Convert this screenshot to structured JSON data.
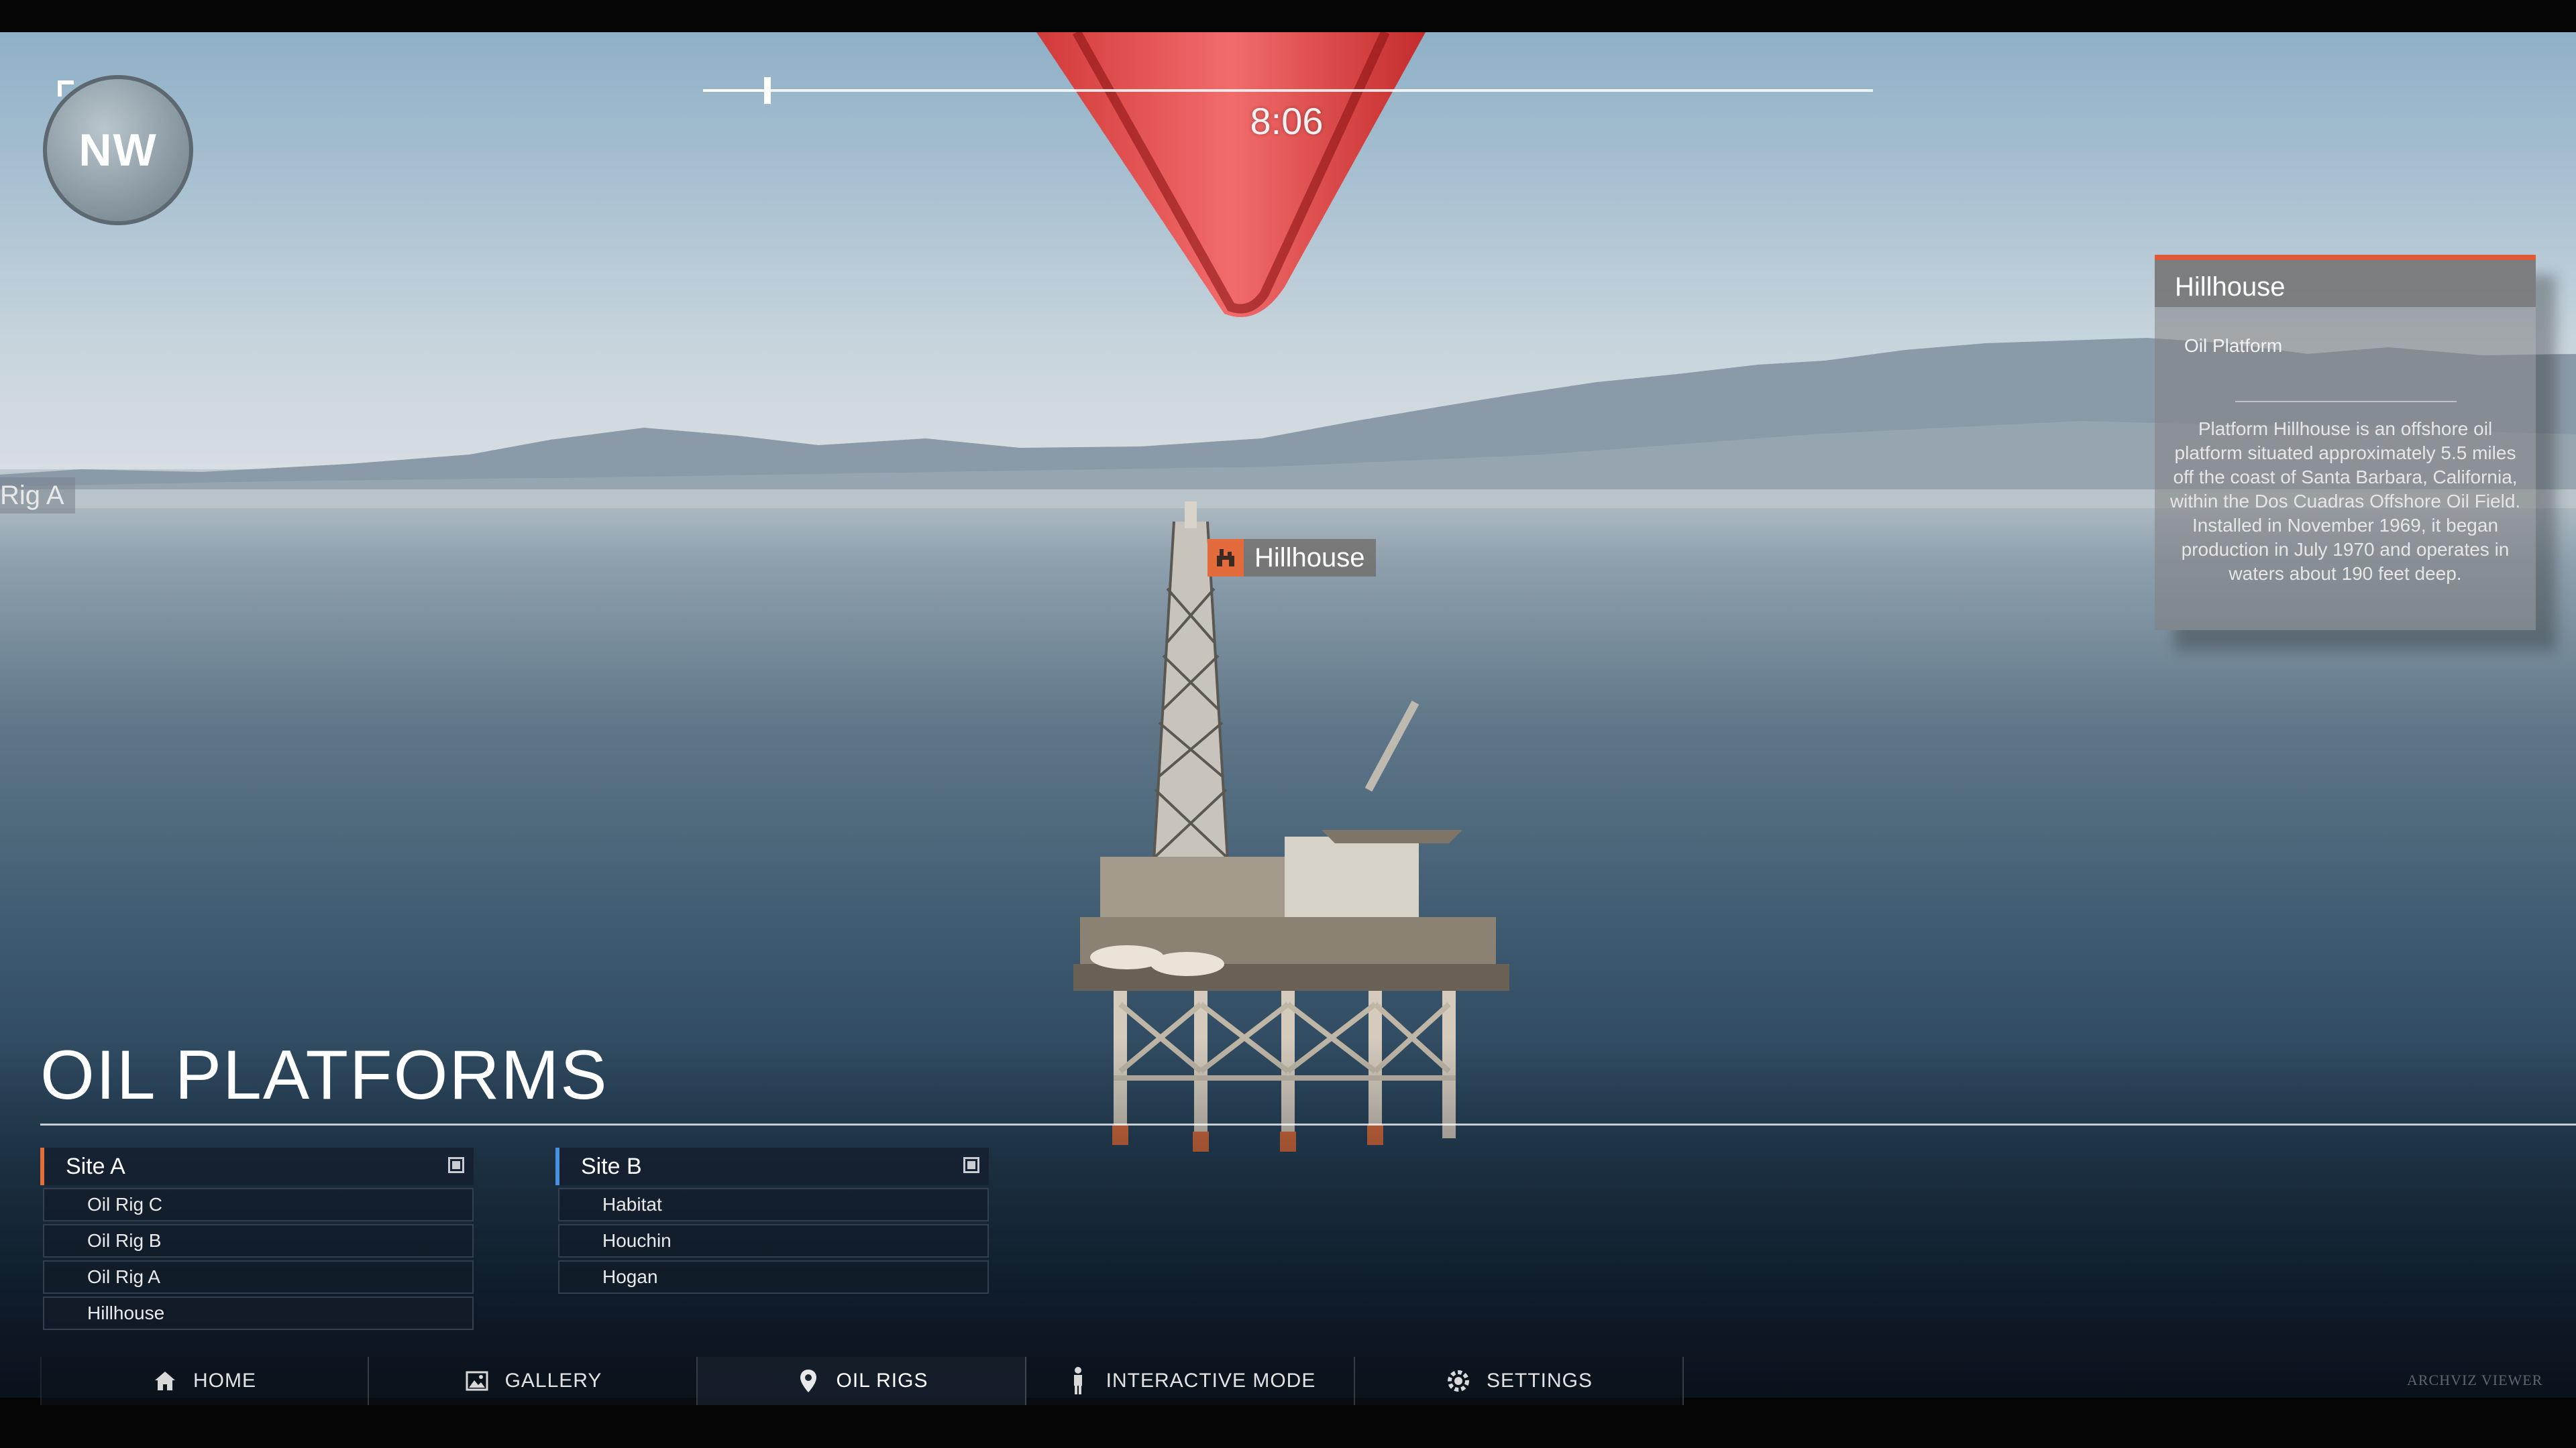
{
  "timeline": {
    "time": "8:06",
    "progress": 0.055
  },
  "compass": {
    "direction": "NW"
  },
  "side_label": {
    "text": "Rig A"
  },
  "map_tag": {
    "label": "Hillhouse",
    "icon": "oil-rig-icon"
  },
  "info_panel": {
    "title": "Hillhouse",
    "type": "Oil Platform",
    "description": "Platform Hillhouse is an offshore oil platform situated approximately 5.5 miles off the coast of Santa Barbara, California, within the Dos Cuadras Offshore Oil Field. Installed in November 1969, it began production in July 1970 and operates in waters about 190 feet deep.",
    "accent_color": "#e05a3a"
  },
  "page_title": "OIL PLATFORMS",
  "sites": [
    {
      "name": "Site A",
      "accent_color": "#e0703a",
      "items": [
        "Oil Rig C",
        "Oil Rig B",
        "Oil Rig A",
        "Hillhouse"
      ]
    },
    {
      "name": "Site B",
      "accent_color": "#4a90e2",
      "items": [
        "Habitat",
        "Houchin",
        "Hogan"
      ]
    }
  ],
  "nav": [
    {
      "label": "HOME",
      "icon": "home-icon",
      "active": false
    },
    {
      "label": "GALLERY",
      "icon": "gallery-icon",
      "active": false
    },
    {
      "label": "OIL RIGS",
      "icon": "map-pin-icon",
      "active": true
    },
    {
      "label": "INTERACTIVE MODE",
      "icon": "person-icon",
      "active": false
    },
    {
      "label": "SETTINGS",
      "icon": "gear-icon",
      "active": false
    }
  ],
  "watermark": "ARCHVIZ VIEWER"
}
